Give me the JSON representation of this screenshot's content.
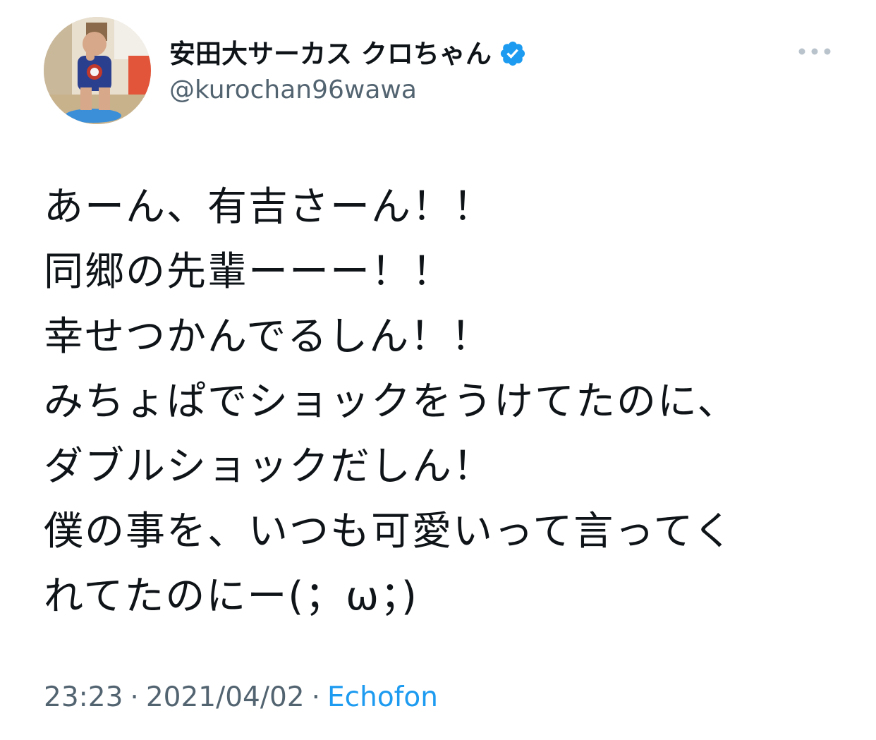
{
  "tweet": {
    "author": {
      "display_name": "安田大サーカス クロちゃん",
      "handle": "@kurochan96wawa",
      "verified": true,
      "avatar_icon": "profile-photo"
    },
    "menu_icon": "more-horizontal-icon",
    "text_lines": [
      "あーん、有吉さーん！！",
      "同郷の先輩ーーー！！",
      "幸せつかんでるしん！！",
      "みちょぱでショックをうけてたのに、",
      "ダブルショックだしん！",
      "僕の事を、いつも可愛いって言ってく",
      "れてたのにー(；ω；)"
    ],
    "time": "23:23",
    "separator": "·",
    "date": "2021/04/02",
    "source": "Echofon"
  },
  "colors": {
    "text": "#0f1419",
    "secondary": "#536471",
    "accent": "#1d9bf0"
  }
}
